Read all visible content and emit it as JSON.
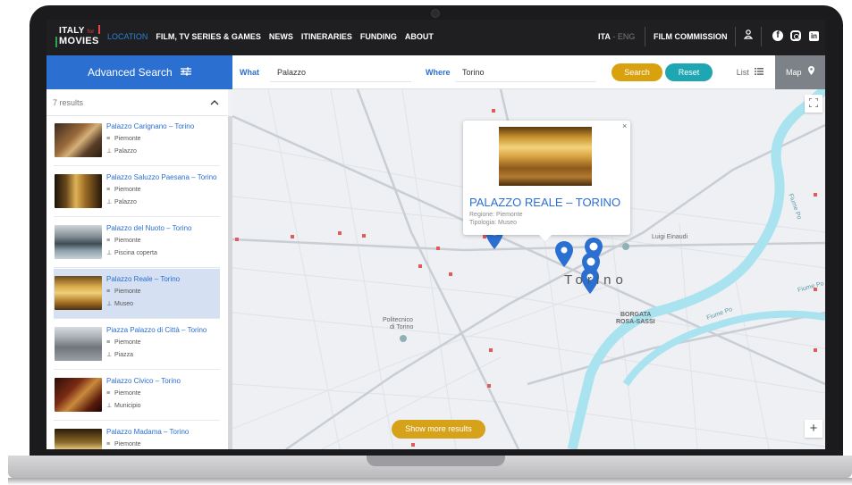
{
  "header": {
    "logo_line1": "ITALY",
    "logo_for": "for",
    "logo_line2": "MOVIES",
    "nav": [
      "LOCATION",
      "FILM, TV SERIES & GAMES",
      "NEWS",
      "ITINERARIES",
      "FUNDING",
      "ABOUT"
    ],
    "lang_active": "ITA",
    "lang_sep": " - ",
    "lang_other": "ENG",
    "film_commission": "FILM COMMISSION",
    "icons": [
      "user-icon",
      "facebook-icon",
      "instagram-icon",
      "linkedin-icon"
    ]
  },
  "search": {
    "advanced_label": "Advanced Search",
    "what_label": "What",
    "what_value": "Palazzo",
    "where_label": "Where",
    "where_value": "Torino",
    "search_button": "Search",
    "reset_button": "Reset",
    "list_tab": "List",
    "map_tab": "Map"
  },
  "results": {
    "count_label": "7 results",
    "items": [
      {
        "title": "Palazzo Carignano – Torino",
        "region": "Piemonte",
        "type": "Palazzo"
      },
      {
        "title": "Palazzo Saluzzo Paesana – Torino",
        "region": "Piemonte",
        "type": "Palazzo"
      },
      {
        "title": "Palazzo del Nuoto – Torino",
        "region": "Piemonte",
        "type": "Piscina coperta"
      },
      {
        "title": "Palazzo Reale – Torino",
        "region": "Piemonte",
        "type": "Museo"
      },
      {
        "title": "Piazza Palazzo di Città – Torino",
        "region": "Piemonte",
        "type": "Piazza"
      },
      {
        "title": "Palazzo Civico – Torino",
        "region": "Piemonte",
        "type": "Municipio"
      },
      {
        "title": "Palazzo Madama – Torino",
        "region": "Piemonte",
        "type": ""
      }
    ],
    "selected_index": 3
  },
  "map": {
    "popup_title": "PALAZZO REALE – TORINO",
    "popup_region": "Regione: Piemonte",
    "popup_type": "Tipologia: Museo",
    "popup_close": "×",
    "city_label": "Torino",
    "label_politecnico_1": "Politecnico",
    "label_politecnico_2": "di Torino",
    "label_borgata_1": "BORGATA",
    "label_borgata_2": "ROSA-SASSI",
    "label_luigi": "Luigi Einaudi",
    "label_river_1": "Fiume Po",
    "label_river_2": "Fiume Po",
    "label_river_3": "Fiume Po",
    "zoom_in": "+",
    "show_more": "Show more results",
    "accent": "#2b6fd1",
    "river_color": "#a8e3ef"
  }
}
